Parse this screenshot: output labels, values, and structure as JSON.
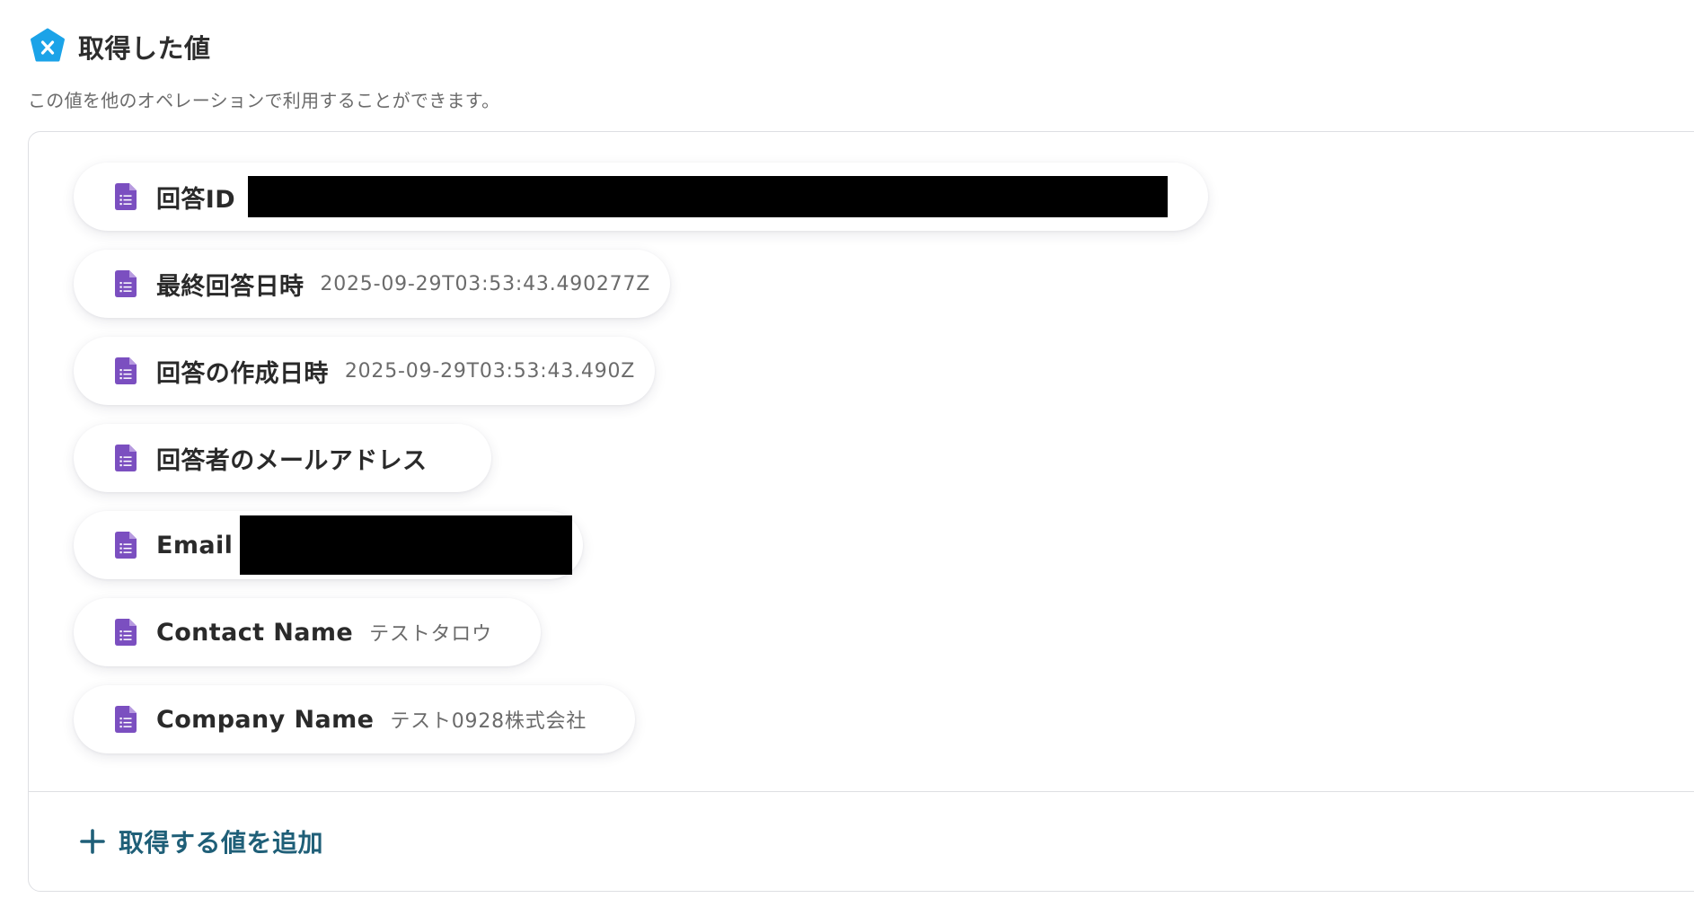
{
  "header": {
    "logo_icon": "yoom-x-hexagon-icon",
    "title": "取得した値",
    "description": "この値を他のオペレーションで利用することができます。"
  },
  "values": [
    {
      "label": "回答ID",
      "value": "",
      "redacted": true
    },
    {
      "label": "最終回答日時",
      "value": "2025-09-29T03:53:43.490277Z",
      "redacted": false
    },
    {
      "label": "回答の作成日時",
      "value": "2025-09-29T03:53:43.490Z",
      "redacted": false
    },
    {
      "label": "回答者のメールアドレス",
      "value": "",
      "redacted": false
    },
    {
      "label": "Email",
      "value": "",
      "redacted": true
    },
    {
      "label": "Contact Name",
      "value": "テストタロウ",
      "redacted": false
    },
    {
      "label": "Company Name",
      "value": "テスト0928株式会社",
      "redacted": false
    }
  ],
  "item_icon": "google-forms-document-icon",
  "add_button": {
    "icon": "plus-icon",
    "label": "取得する値を追加"
  },
  "colors": {
    "logo": "#1ba3e8",
    "form_icon": "#7b4fc0",
    "add_text": "#1f5f78",
    "border": "#dedfe3"
  }
}
